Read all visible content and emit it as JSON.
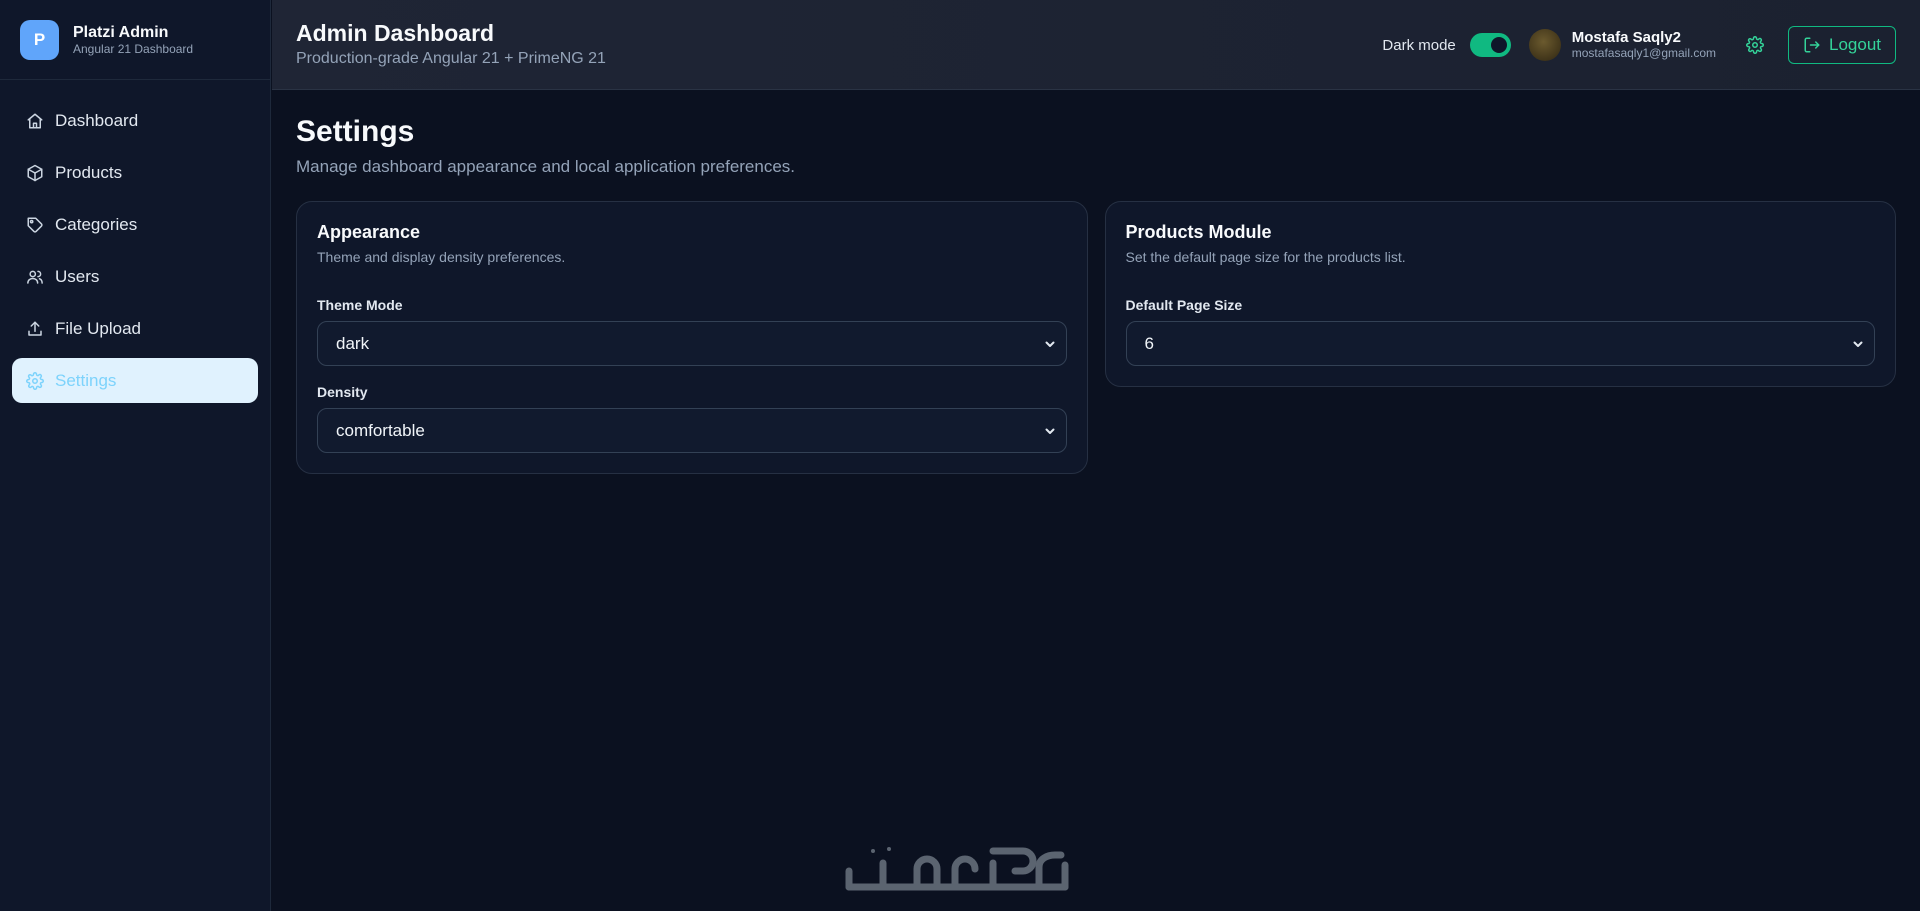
{
  "brand": {
    "logo_letter": "P",
    "title": "Platzi Admin",
    "subtitle": "Angular 21 Dashboard"
  },
  "sidebar": {
    "items": [
      {
        "label": "Dashboard",
        "icon": "home-icon"
      },
      {
        "label": "Products",
        "icon": "box-icon"
      },
      {
        "label": "Categories",
        "icon": "tag-icon"
      },
      {
        "label": "Users",
        "icon": "users-icon"
      },
      {
        "label": "File Upload",
        "icon": "upload-icon"
      },
      {
        "label": "Settings",
        "icon": "gear-icon",
        "active": true
      }
    ]
  },
  "header": {
    "title": "Admin Dashboard",
    "subtitle": "Production-grade Angular 21 + PrimeNG 21",
    "dark_mode_label": "Dark mode",
    "dark_mode_on": true,
    "user_name": "Mostafa Saqly2",
    "user_email": "mostafasaqly1@gmail.com",
    "logout_label": "Logout"
  },
  "page": {
    "title": "Settings",
    "subtitle": "Manage dashboard appearance and local application preferences."
  },
  "appearance": {
    "title": "Appearance",
    "subtitle": "Theme and display density preferences.",
    "theme_label": "Theme Mode",
    "theme_value": "dark",
    "density_label": "Density",
    "density_value": "comfortable"
  },
  "products_module": {
    "title": "Products Module",
    "subtitle": "Set the default page size for the products list.",
    "page_size_label": "Default Page Size",
    "page_size_value": "6"
  },
  "watermark": {
    "text": "خمسات"
  },
  "colors": {
    "accent": "#10b981",
    "active_bg": "#e0f2fe",
    "active_text": "#7dd3fc",
    "brand": "#60a5fa"
  }
}
